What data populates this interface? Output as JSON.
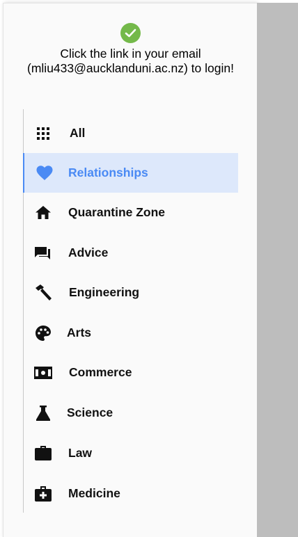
{
  "colors": {
    "accent": "#4a8af4",
    "active_bg": "#dde8fb",
    "success": "#74b94a",
    "scrim": "#bdbdbd"
  },
  "notice": {
    "icon": "check-circle-icon",
    "text": "Click the link in your email (mliu433@aucklanduni.ac.nz) to login!"
  },
  "menu": {
    "items": [
      {
        "label": "All",
        "icon": "grid-icon",
        "active": false
      },
      {
        "label": "Relationships",
        "icon": "heart-icon",
        "active": true
      },
      {
        "label": "Quarantine Zone",
        "icon": "home-icon",
        "active": false
      },
      {
        "label": "Advice",
        "icon": "chat-bubbles-icon",
        "active": false
      },
      {
        "label": "Engineering",
        "icon": "hammer-icon",
        "active": false
      },
      {
        "label": "Arts",
        "icon": "palette-icon",
        "active": false
      },
      {
        "label": "Commerce",
        "icon": "money-icon",
        "active": false
      },
      {
        "label": "Science",
        "icon": "flask-icon",
        "active": false
      },
      {
        "label": "Law",
        "icon": "briefcase-icon",
        "active": false
      },
      {
        "label": "Medicine",
        "icon": "medical-bag-icon",
        "active": false
      }
    ]
  }
}
